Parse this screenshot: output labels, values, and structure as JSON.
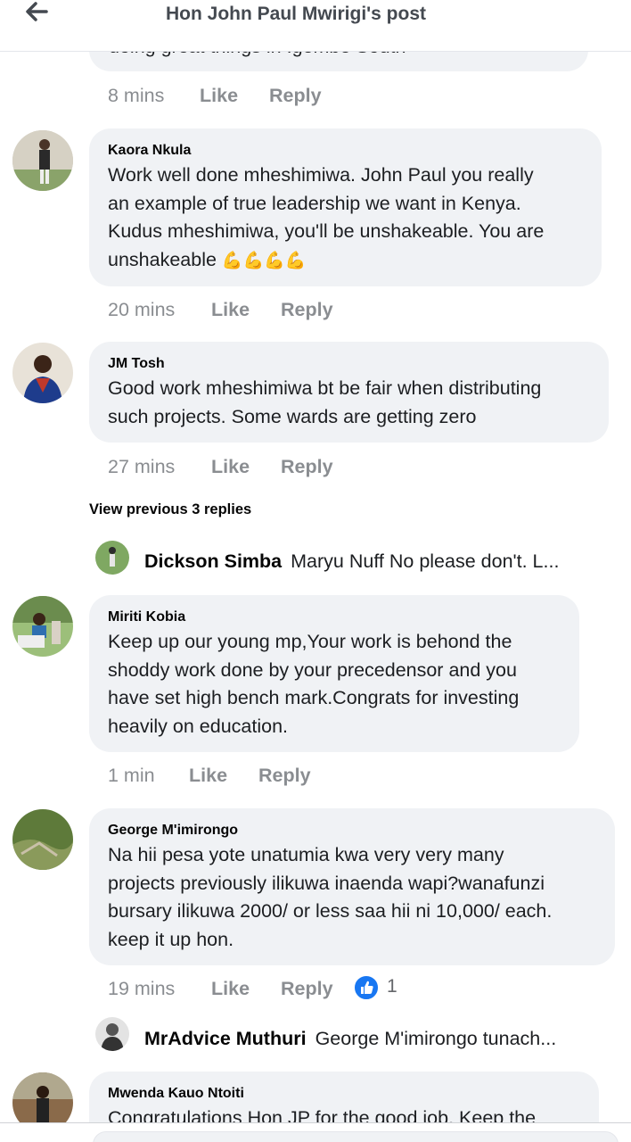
{
  "header": {
    "title": "Hon John Paul Mwirigi's post"
  },
  "top_clipped": {
    "text": "doing great things in Igembe South",
    "time": "8 mins",
    "like": "Like",
    "reply": "Reply"
  },
  "comments": [
    {
      "name": "Kaora Nkula",
      "lines": [
        "Work well done mheshimiwa. John Paul you really",
        "an example of true leadership we want in Kenya.",
        "Kudus mheshimiwa, you'll be unshakeable. You are",
        "unshakeable"
      ],
      "emoji": "💪💪💪💪",
      "time": "20 mins",
      "like": "Like",
      "reply": "Reply"
    },
    {
      "name": "JM Tosh",
      "lines": [
        "Good work mheshimiwa bt be fair when distributing",
        "such projects. Some wards are getting zero"
      ],
      "time": "27 mins",
      "like": "Like",
      "reply": "Reply",
      "view_previous": "View previous 3 replies",
      "reply_preview": {
        "name": "Dickson Simba",
        "text": "Maryu Nuff No please don't. L..."
      }
    },
    {
      "name": "Miriti Kobia",
      "lines": [
        "Keep up our young mp,Your work is behond the",
        "shoddy work done by your precedensor and you",
        "have set high bench mark.Congrats for investing",
        "heavily on education."
      ],
      "time": "1 min",
      "like": "Like",
      "reply": "Reply"
    },
    {
      "name": "George M'imirongo",
      "lines": [
        "Na hii pesa yote unatumia kwa very very many",
        "projects previously ilikuwa inaenda wapi?wanafunzi",
        "bursary ilikuwa 2000/ or less saa hii ni 10,000/ each.",
        "keep it up hon."
      ],
      "time": "19 mins",
      "like": "Like",
      "reply": "Reply",
      "reaction_count": "1",
      "reply_preview": {
        "name": "MrAdvice Muthuri",
        "text": "George M'imirongo tunach..."
      }
    },
    {
      "name": "Mwenda Kauo Ntoiti",
      "lines": [
        "Congratulations Hon JP for the good job. Keep the"
      ]
    }
  ]
}
